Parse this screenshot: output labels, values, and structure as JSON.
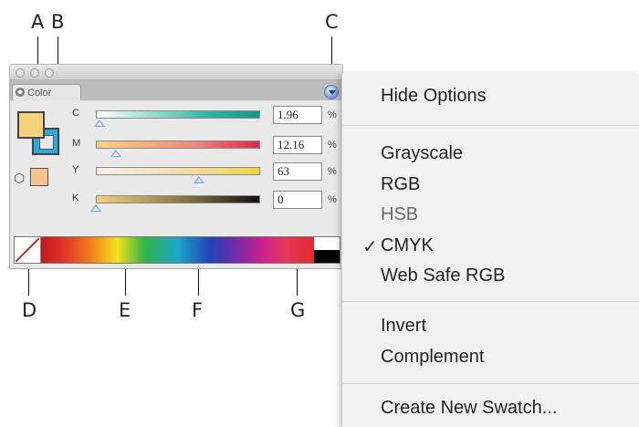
{
  "callouts": {
    "a": "A",
    "b": "B",
    "c": "C",
    "d": "D",
    "e": "E",
    "f": "F",
    "g": "G"
  },
  "panel": {
    "tab_label": "Color",
    "tab_icon": "color-panel-icon",
    "menu_button_icon": "panel-menu-icon",
    "fill_color": "#f6d27a",
    "stroke_color": "#2aa9df",
    "small_swatch_color": "#f6c58a",
    "channels": [
      {
        "label": "C",
        "value": "1.96",
        "unit": "%",
        "percent": 1.96
      },
      {
        "label": "M",
        "value": "12.16",
        "unit": "%",
        "percent": 12.16
      },
      {
        "label": "Y",
        "value": "63",
        "unit": "%",
        "percent": 63
      },
      {
        "label": "K",
        "value": "0",
        "unit": "%",
        "percent": 0
      }
    ]
  },
  "menu": {
    "items": [
      {
        "label": "Hide Options"
      },
      {
        "label": "Grayscale"
      },
      {
        "label": "RGB"
      },
      {
        "label": "HSB",
        "dim": true
      },
      {
        "label": "CMYK",
        "checked": true
      },
      {
        "label": "Web Safe RGB"
      },
      {
        "label": "Invert"
      },
      {
        "label": "Complement"
      },
      {
        "label": "Create New Swatch..."
      }
    ]
  }
}
